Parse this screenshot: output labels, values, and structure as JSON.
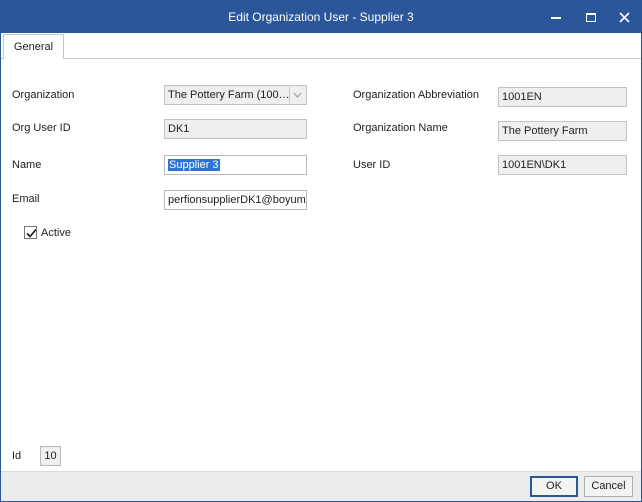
{
  "window": {
    "title": "Edit Organization User - Supplier 3",
    "minimize_icon": "minimize-icon",
    "maximize_icon": "maximize-icon",
    "close_icon": "close-icon",
    "titlebar_color": "#2b579a"
  },
  "tabs": [
    {
      "label": "General",
      "active": true
    }
  ],
  "form": {
    "organization": {
      "label": "Organization",
      "value": "The Pottery Farm (100…"
    },
    "org_user_id": {
      "label": "Org User ID",
      "value": "DK1"
    },
    "name": {
      "label": "Name",
      "value": "Supplier 3"
    },
    "email": {
      "label": "Email",
      "value": "perfionsupplierDK1@boyum-"
    },
    "active": {
      "label": "Active",
      "checked": true
    },
    "organization_abbreviation": {
      "label": "Organization Abbreviation",
      "value": "1001EN"
    },
    "organization_name": {
      "label": "Organization Name",
      "value": "The Pottery Farm"
    },
    "user_id": {
      "label": "User ID",
      "value": "1001EN\\DK1"
    },
    "id": {
      "label": "Id",
      "value": "10"
    }
  },
  "buttons": {
    "ok": "OK",
    "cancel": "Cancel"
  }
}
